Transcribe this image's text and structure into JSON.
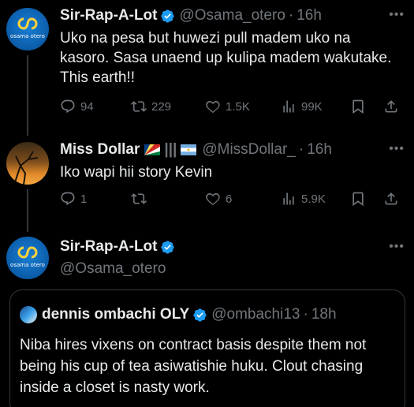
{
  "tweets": [
    {
      "name": "Sir-Rap-A-Lot",
      "handle": "@Osama_otero",
      "time": "16h",
      "text": "Uko na pesa but huwezi pull madem uko na kasoro. Sasa unaend up kulipa madem wakutake. This earth!!",
      "replies": "94",
      "retweets": "229",
      "likes": "1.5K",
      "views": "99K",
      "avatar_brand": "osama otero"
    },
    {
      "name": "Miss Dollar",
      "handle": "@MissDollar_",
      "time": "16h",
      "text": "Iko wapi hii story Kevin",
      "replies": "1",
      "retweets": "",
      "likes": "6",
      "views": "5.9K",
      "name_separator": "|||"
    },
    {
      "name": "Sir-Rap-A-Lot",
      "handle": "@Osama_otero",
      "avatar_brand": "osama otero"
    }
  ],
  "quote": {
    "name": "dennis ombachi OLY",
    "handle": "@ombachi13",
    "time": "18h",
    "text": "Niba hires vixens on contract basis despite them not being his cup of tea asiwatishie huku. Clout chasing inside a closet is nasty work."
  },
  "ui": {
    "more": "•••",
    "dot": "·"
  },
  "colors": {
    "verified": "#1d9bf0",
    "muted": "#71767b",
    "text": "#e7e9ea",
    "divider": "#333639"
  }
}
